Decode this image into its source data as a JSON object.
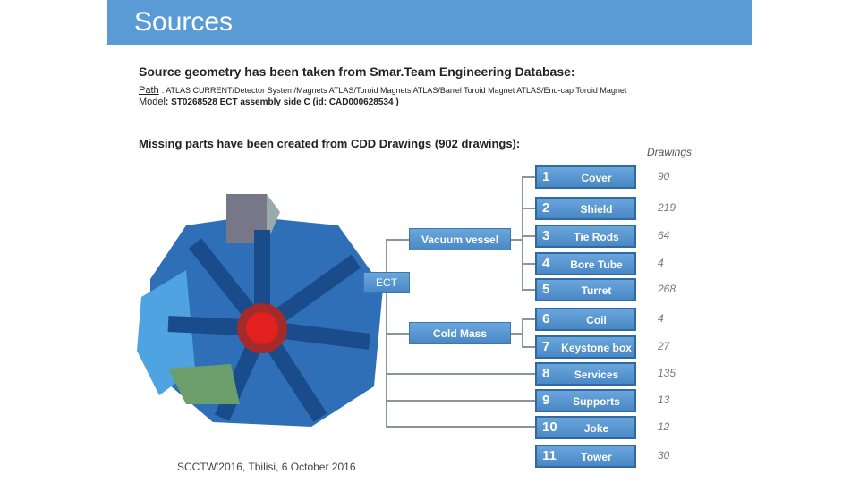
{
  "title": "Sources",
  "intro": "Source geometry has been taken from Smar.Team Engineering Database:",
  "path_label": "Path",
  "path_value": ":  ATLAS CURRENT/Detector System/Magnets ATLAS/Toroid Magnets ATLAS/Barrel Toroid Magnet ATLAS/End-cap Toroid Magnet",
  "model_label": "Model",
  "model_value": ":  ST0268528 ECT assembly side C (id: CAD000628534 )",
  "missing": "Missing parts have been created from CDD Drawings (902 drawings):",
  "drawings_header": "Drawings",
  "tree": {
    "root": "ECT",
    "groups": [
      "Vacuum vessel",
      "Cold Mass"
    ]
  },
  "parts": [
    {
      "n": "1",
      "label": "Cover",
      "drawings": "90"
    },
    {
      "n": "2",
      "label": "Shield",
      "drawings": "219"
    },
    {
      "n": "3",
      "label": "Tie Rods",
      "drawings": "64"
    },
    {
      "n": "4",
      "label": "Bore Tube",
      "drawings": "4"
    },
    {
      "n": "5",
      "label": "Turret",
      "drawings": "268"
    },
    {
      "n": "6",
      "label": "Coil",
      "drawings": "4"
    },
    {
      "n": "7",
      "label": "Keystone box",
      "drawings": "27"
    },
    {
      "n": "8",
      "label": "Services",
      "drawings": "135"
    },
    {
      "n": "9",
      "label": "Supports",
      "drawings": "13"
    },
    {
      "n": "10",
      "label": "Joke",
      "drawings": "12"
    },
    {
      "n": "11",
      "label": "Tower",
      "drawings": "30"
    }
  ],
  "footer": "SCCTW'2016, Tbilisi, 6 October 2016",
  "colors": {
    "header": "#5b9bd5",
    "box": "#5b9bd5",
    "line": "#8a949c"
  }
}
